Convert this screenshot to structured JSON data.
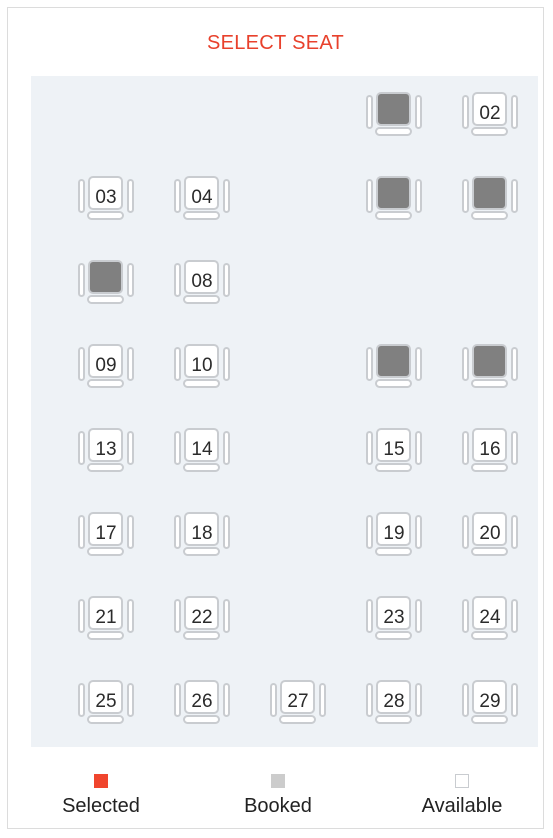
{
  "header": {
    "title": "SELECT SEAT"
  },
  "colors": {
    "accent": "#e8412c",
    "booked_fill": "#808080",
    "seat_outline": "#c9ccd0",
    "deck_background": "#eef2f6"
  },
  "seats": [
    {
      "row": 1,
      "col": 4,
      "label": "",
      "status": "booked"
    },
    {
      "row": 1,
      "col": 5,
      "label": "02",
      "status": "available"
    },
    {
      "row": 2,
      "col": 1,
      "label": "03",
      "status": "available"
    },
    {
      "row": 2,
      "col": 2,
      "label": "04",
      "status": "available"
    },
    {
      "row": 2,
      "col": 4,
      "label": "",
      "status": "booked"
    },
    {
      "row": 2,
      "col": 5,
      "label": "",
      "status": "booked"
    },
    {
      "row": 3,
      "col": 1,
      "label": "",
      "status": "booked"
    },
    {
      "row": 3,
      "col": 2,
      "label": "08",
      "status": "available"
    },
    {
      "row": 4,
      "col": 1,
      "label": "09",
      "status": "available"
    },
    {
      "row": 4,
      "col": 2,
      "label": "10",
      "status": "available"
    },
    {
      "row": 4,
      "col": 4,
      "label": "",
      "status": "booked"
    },
    {
      "row": 4,
      "col": 5,
      "label": "",
      "status": "booked"
    },
    {
      "row": 5,
      "col": 1,
      "label": "13",
      "status": "available"
    },
    {
      "row": 5,
      "col": 2,
      "label": "14",
      "status": "available"
    },
    {
      "row": 5,
      "col": 4,
      "label": "15",
      "status": "available"
    },
    {
      "row": 5,
      "col": 5,
      "label": "16",
      "status": "available"
    },
    {
      "row": 6,
      "col": 1,
      "label": "17",
      "status": "available"
    },
    {
      "row": 6,
      "col": 2,
      "label": "18",
      "status": "available"
    },
    {
      "row": 6,
      "col": 4,
      "label": "19",
      "status": "available"
    },
    {
      "row": 6,
      "col": 5,
      "label": "20",
      "status": "available"
    },
    {
      "row": 7,
      "col": 1,
      "label": "21",
      "status": "available"
    },
    {
      "row": 7,
      "col": 2,
      "label": "22",
      "status": "available"
    },
    {
      "row": 7,
      "col": 4,
      "label": "23",
      "status": "available"
    },
    {
      "row": 7,
      "col": 5,
      "label": "24",
      "status": "available"
    },
    {
      "row": 8,
      "col": 1,
      "label": "25",
      "status": "available"
    },
    {
      "row": 8,
      "col": 2,
      "label": "26",
      "status": "available"
    },
    {
      "row": 8,
      "col": 3,
      "label": "27",
      "status": "available"
    },
    {
      "row": 8,
      "col": 4,
      "label": "28",
      "status": "available"
    },
    {
      "row": 8,
      "col": 5,
      "label": "29",
      "status": "available"
    }
  ],
  "legend": {
    "selected": {
      "label": "Selected",
      "color": "#f0452d"
    },
    "booked": {
      "label": "Booked",
      "color": "#cccccc"
    },
    "available": {
      "label": "Available",
      "color": "#ffffff"
    }
  }
}
